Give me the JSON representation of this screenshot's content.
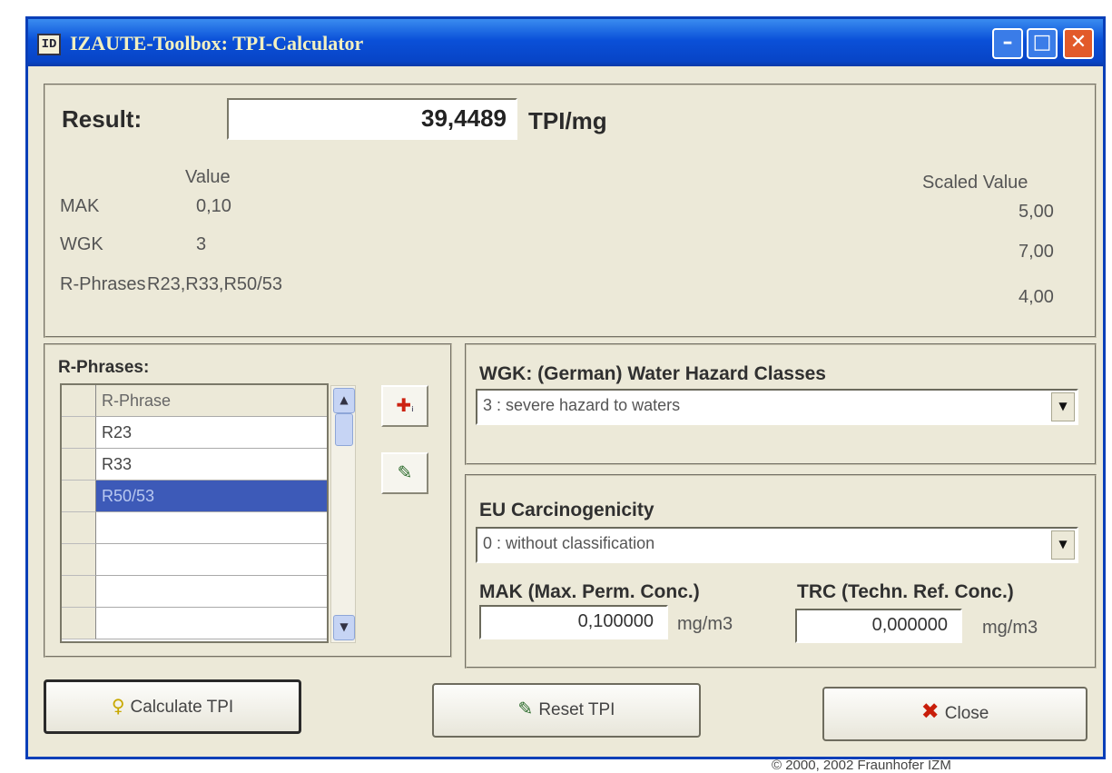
{
  "window": {
    "title": "IZAUTE-Toolbox: TPI-Calculator",
    "min_glyph": "–",
    "max_glyph": "□",
    "close_glyph": "✕"
  },
  "result": {
    "label": "Result:",
    "value": "39,4489",
    "unit": "TPI/mg"
  },
  "params": {
    "value_header": "Value",
    "scaled_header": "Scaled Value",
    "rows": [
      {
        "name": "MAK",
        "value": "0,10",
        "scaled": "5,00"
      },
      {
        "name": "WGK",
        "value": "3",
        "scaled": "7,00"
      },
      {
        "name": "R-Phrases",
        "value": "R23,R33,R50/53",
        "scaled": "4,00"
      }
    ]
  },
  "rphrases": {
    "label": "R-Phrases:",
    "column_header": "R-Phrase",
    "rows": [
      "R23",
      "R33",
      "R50/53",
      "",
      "",
      "",
      ""
    ],
    "selected_index": 2,
    "add_icon": "add-phrase-icon",
    "clear_icon": "eraser-icon"
  },
  "wgk": {
    "label": "WGK: (German) Water Hazard Classes",
    "selected": "3 : severe hazard to waters"
  },
  "eu": {
    "label": "EU Carcinogenicity",
    "selected": "0 : without classification"
  },
  "mak": {
    "label": "MAK (Max. Perm. Conc.)",
    "value": "0,100000",
    "unit": "mg/m3"
  },
  "trc": {
    "label": "TRC (Techn. Ref. Conc.)",
    "value": "0,000000",
    "unit": "mg/m3"
  },
  "buttons": {
    "calculate": "Calculate TPI",
    "reset": "Reset TPI",
    "close": "Close",
    "calculate_icon": "lightbulb-icon",
    "reset_icon": "eraser-icon",
    "close_icon": "x-icon"
  },
  "copyright": "© 2000, 2002 Fraunhofer IZM"
}
